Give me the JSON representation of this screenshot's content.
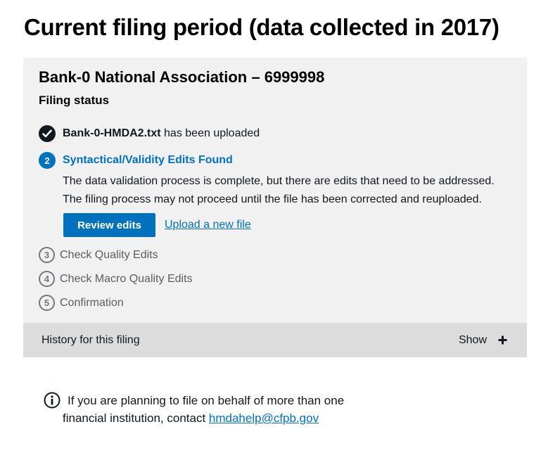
{
  "page": {
    "title": "Current filing period (data collected in 2017)"
  },
  "institution": {
    "name": "Bank-0 National Association – 6999998"
  },
  "filing_status": {
    "heading": "Filing status",
    "steps": [
      {
        "badge": "✓",
        "file_name": "Bank-0-HMDA2.txt",
        "text": "has been uploaded",
        "state": "done"
      },
      {
        "badge": "2",
        "label": "Syntactical/Validity Edits Found",
        "state": "active"
      },
      {
        "badge": "3",
        "label": "Check Quality Edits",
        "state": "pending"
      },
      {
        "badge": "4",
        "label": "Check Macro Quality Edits",
        "state": "pending"
      },
      {
        "badge": "5",
        "label": "Confirmation",
        "state": "pending"
      }
    ],
    "active_description": {
      "line1": "The data validation process is complete, but there are edits that need to be addressed.",
      "line2": "The filing process may not proceed until the file has been corrected and reuploaded."
    },
    "actions": {
      "review_label": "Review edits",
      "upload_label": "Upload a new file"
    }
  },
  "history": {
    "label": "History for this filing",
    "toggle_label": "Show",
    "toggle_icon": "plus-icon"
  },
  "note": {
    "icon": "info-icon",
    "line1": "If you are planning to file on behalf of more than one",
    "line2_prefix": "financial institution, contact ",
    "email": "hmdahelp@cfpb.gov"
  },
  "colors": {
    "accent": "#0071bc",
    "card_bg": "#f1f1f1",
    "history_bg": "#dcdcdc",
    "muted": "#75787b"
  }
}
